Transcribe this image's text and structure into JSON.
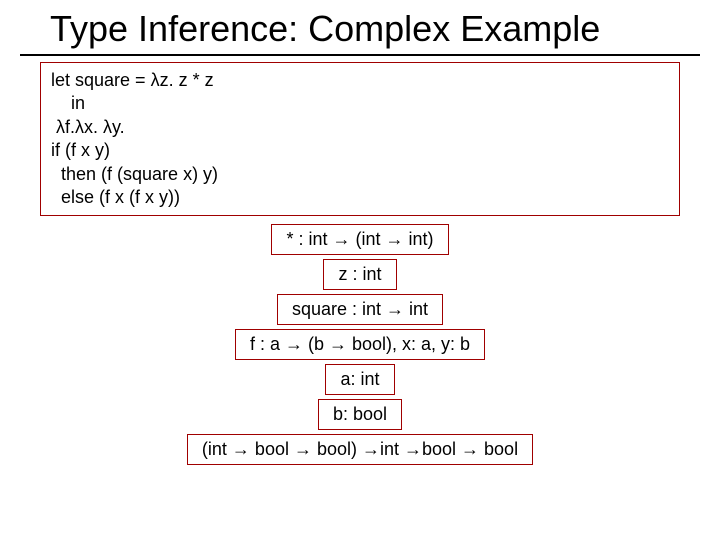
{
  "title": "Type Inference: Complex Example",
  "code": {
    "l1": "let square = λz. z * z",
    "l2": "    in",
    "l3": " λf.λx. λy.",
    "l4": "if (f x y)",
    "l5": "  then (f (square x) y)",
    "l6": "  else (f x (f x y))"
  },
  "boxes": {
    "b1": "* : int → (int → int)",
    "b2": "z : int",
    "b3": "square : int → int",
    "b4": "f : a → (b → bool), x: a, y: b",
    "b5": "a: int",
    "b6": "b: bool",
    "b7": "(int → bool → bool) →int →bool → bool"
  }
}
